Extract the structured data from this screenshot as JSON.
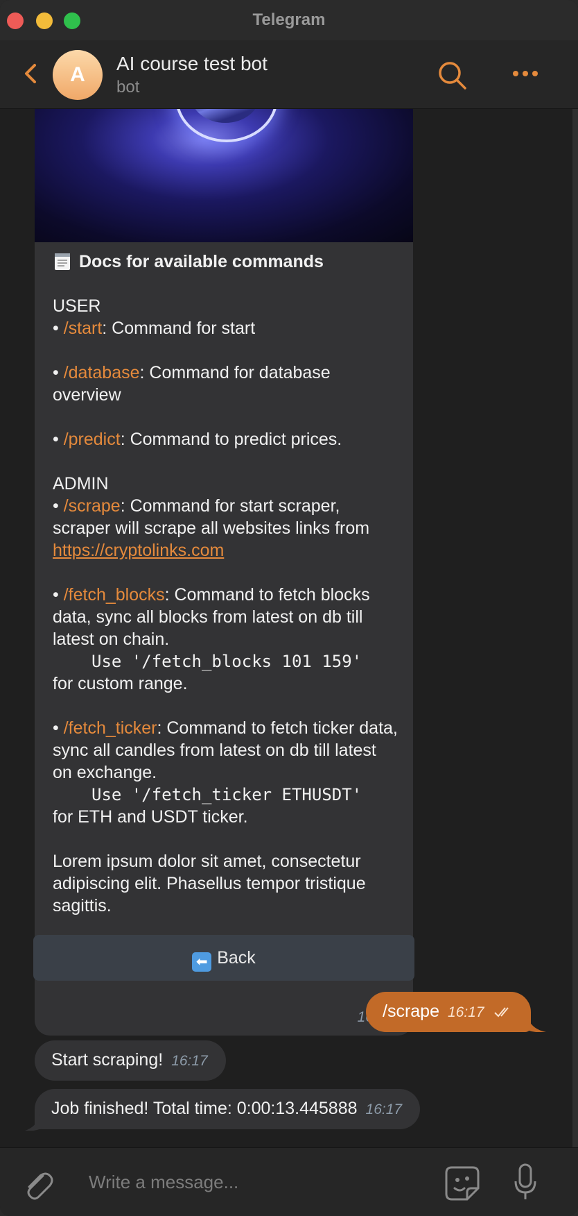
{
  "window": {
    "title": "Telegram"
  },
  "header": {
    "avatar_letter": "A",
    "name": "AI course test bot",
    "subtitle": "bot"
  },
  "message_docs": {
    "title": "Docs for available commands",
    "time": "16:17",
    "user_heading": "USER",
    "start_cmd": "/start",
    "start_desc": ": Command for start",
    "database_cmd": "/database",
    "database_desc": ": Command for database overview",
    "predict_cmd": "/predict",
    "predict_desc": ": Command to predict prices.",
    "admin_heading": "ADMIN",
    "scrape_cmd": "/scrape",
    "scrape_desc": ": Command for start scraper, scraper will scrape all websites links from ",
    "scrape_link": "https://cryptolinks.com",
    "fetch_blocks_cmd": "/fetch_blocks",
    "fetch_blocks_desc": ": Command to fetch blocks data, sync all blocks from latest on db till latest on chain.",
    "fetch_blocks_use": "Use '/fetch_blocks 101 159'",
    "fetch_blocks_use_suffix": "for custom range.",
    "fetch_ticker_cmd": "/fetch_ticker",
    "fetch_ticker_desc": ": Command to fetch ticker data, sync all candles from latest on db till latest on exchange.",
    "fetch_ticker_use": "Use '/fetch_ticker ETHUSDT'",
    "fetch_ticker_use_suffix": "for ETH and USDT ticker.",
    "lorem": "Lorem ipsum dolor sit amet, consectetur adipiscing elit. Phasellus tempor tristique sagittis."
  },
  "keyboard": {
    "back_label": "Back"
  },
  "outgoing": [
    {
      "text": "/scrape",
      "time": "16:17"
    }
  ],
  "incoming": [
    {
      "text": "Start scraping!",
      "time": "16:17"
    },
    {
      "text": "Job finished! Total time: 0:00:13.445888",
      "time": "16:17"
    }
  ],
  "composer": {
    "placeholder": "Write a message..."
  },
  "colors": {
    "accent": "#e58a3c",
    "outgoing_bubble": "#c26a28",
    "incoming_bubble": "#333335",
    "keyboard_button": "#3a4048"
  },
  "icons": [
    "back-chevron-icon",
    "search-icon",
    "more-dots-icon",
    "notepad-icon",
    "back-arrow-icon",
    "read-check-icon",
    "attach-clip-icon",
    "sticker-icon",
    "microphone-icon"
  ]
}
